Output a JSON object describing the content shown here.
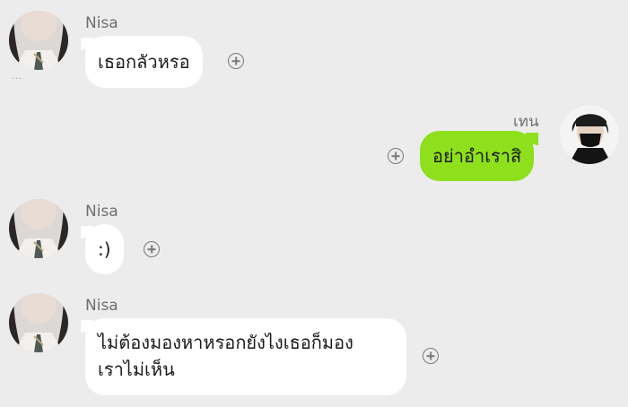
{
  "chat": {
    "messages": [
      {
        "sender": "Nisa",
        "direction": "incoming",
        "text": "เธอกลัวหรอ"
      },
      {
        "sender": "เทน",
        "direction": "outgoing",
        "text": "อย่าอำเราสิ"
      },
      {
        "sender": "Nisa",
        "direction": "incoming",
        "text": ":)"
      },
      {
        "sender": "Nisa",
        "direction": "incoming",
        "text_line1": "ไม่ต้องมองหาหรอกยังไงเธอก็มอง",
        "text_line2": "เราไม่เห็น"
      }
    ],
    "more_indicator": "···"
  },
  "colors": {
    "background": "#ececec",
    "incoming_bubble": "#ffffff",
    "outgoing_bubble": "#8de01b",
    "sender_name": "#6f6f6f"
  },
  "icons": {
    "reaction": "add-reaction-icon"
  }
}
